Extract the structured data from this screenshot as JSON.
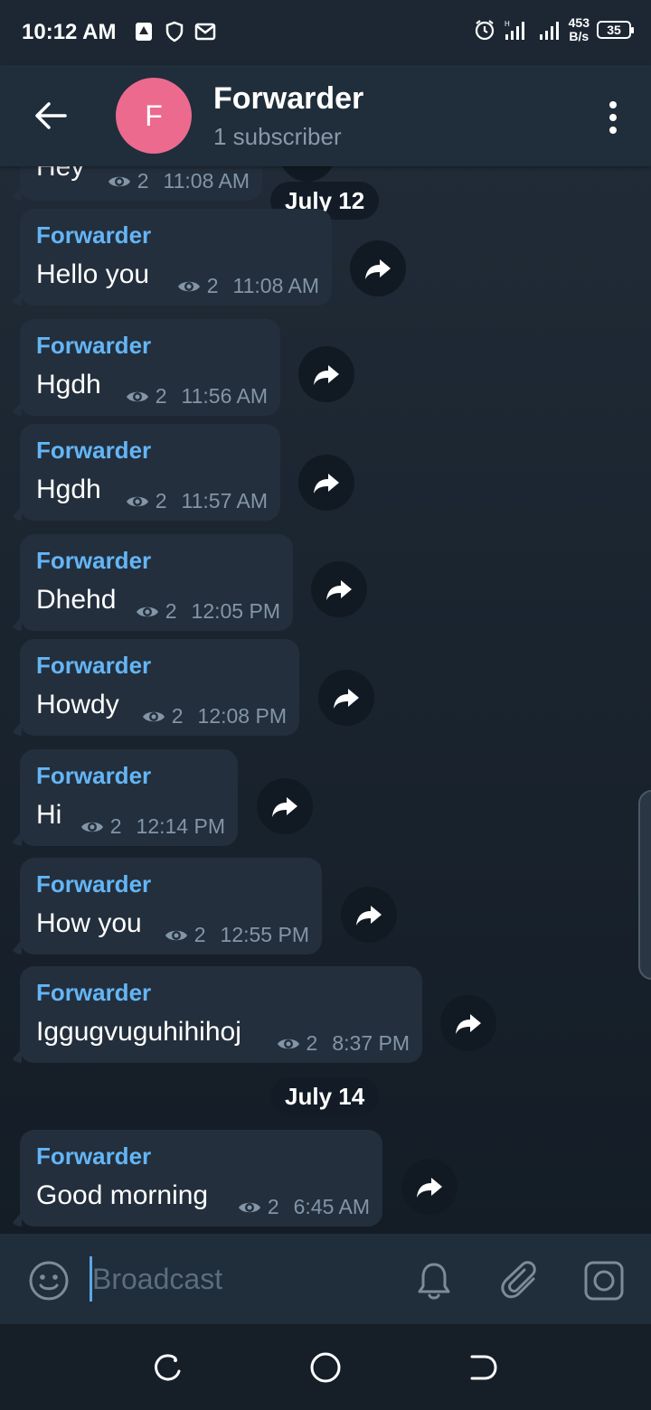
{
  "status_bar": {
    "time": "10:12 AM",
    "net_speed_value": "453",
    "net_speed_unit": "B/s",
    "battery": "35"
  },
  "header": {
    "avatar_letter": "F",
    "title": "Forwarder",
    "subtitle": "1 subscriber",
    "avatar_color": "#ec6a8e"
  },
  "messages": [
    {
      "sender": "",
      "text": "Hey",
      "views": "2",
      "time": "11:08 AM"
    },
    {
      "sender": "Forwarder",
      "text": "Hello you",
      "views": "2",
      "time": "11:08 AM"
    },
    {
      "sender": "Forwarder",
      "text": "Hgdh",
      "views": "2",
      "time": "11:56 AM"
    },
    {
      "sender": "Forwarder",
      "text": "Hgdh",
      "views": "2",
      "time": "11:57 AM"
    },
    {
      "sender": "Forwarder",
      "text": "Dhehd",
      "views": "2",
      "time": "12:05 PM"
    },
    {
      "sender": "Forwarder",
      "text": "Howdy",
      "views": "2",
      "time": "12:08 PM"
    },
    {
      "sender": "Forwarder",
      "text": "Hi",
      "views": "2",
      "time": "12:14 PM"
    },
    {
      "sender": "Forwarder",
      "text": "How you",
      "views": "2",
      "time": "12:55 PM"
    },
    {
      "sender": "Forwarder",
      "text": "Iggugvuguhihihoj",
      "views": "2",
      "time": "8:37 PM"
    },
    {
      "sender": "Forwarder",
      "text": "Good morning",
      "views": "2",
      "time": "6:45 AM"
    }
  ],
  "date_separators": [
    "July 12",
    "July 14"
  ],
  "input": {
    "placeholder": "Broadcast"
  },
  "colors": {
    "sender_name": "#64b5f6",
    "bubble": "#232f3c",
    "header_bg": "#202d3a"
  }
}
